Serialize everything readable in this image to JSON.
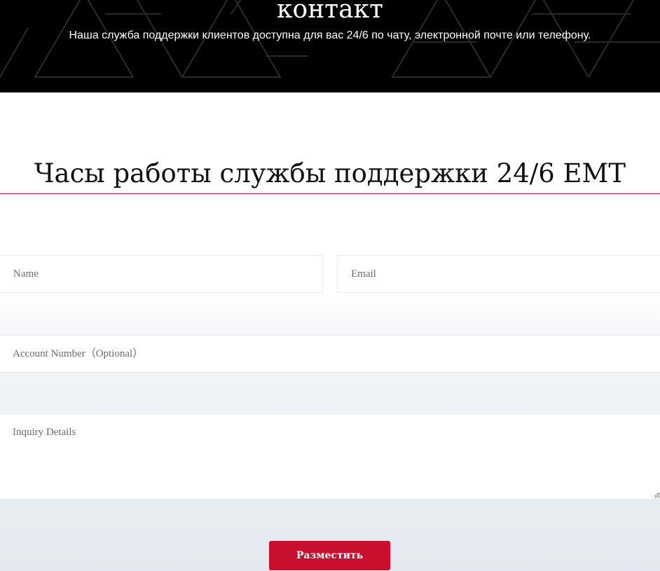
{
  "hero": {
    "title": "контакт",
    "subtitle": "Наша служба поддержки клиентов доступна для вас 24/6 по чату, электронной почте или телефону."
  },
  "hours": {
    "heading": "Часы работы службы поддержки 24/6 EMT"
  },
  "form": {
    "name_placeholder": "Name",
    "email_placeholder": "Email",
    "account_placeholder": "Account Number（Optional）",
    "inquiry_placeholder": "Inquiry Details",
    "submit_label": "Разместить"
  },
  "colors": {
    "hero_bg": "#000000",
    "accent": "#c8102e",
    "rule": "#c3153a"
  }
}
